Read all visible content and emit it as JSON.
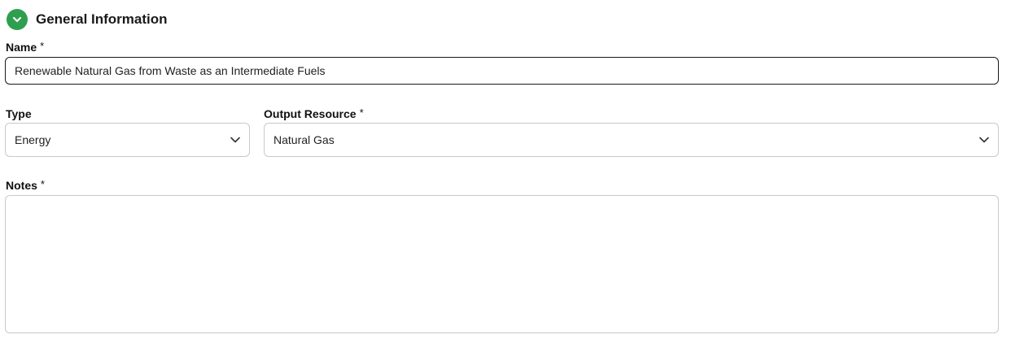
{
  "section": {
    "title": "General Information",
    "toggle_icon": "chevron-down-icon",
    "accent_color": "#2e9f4e"
  },
  "name_field": {
    "label": "Name",
    "required_marker": "*",
    "value": "Renewable Natural Gas from Waste as an Intermediate Fuels"
  },
  "type_field": {
    "label": "Type",
    "selected": "Energy",
    "icon": "chevron-down-icon"
  },
  "output_resource_field": {
    "label": "Output Resource",
    "required_marker": "*",
    "selected": "Natural Gas",
    "icon": "chevron-down-icon"
  },
  "notes_field": {
    "label": "Notes",
    "required_marker": "*",
    "value": ""
  }
}
